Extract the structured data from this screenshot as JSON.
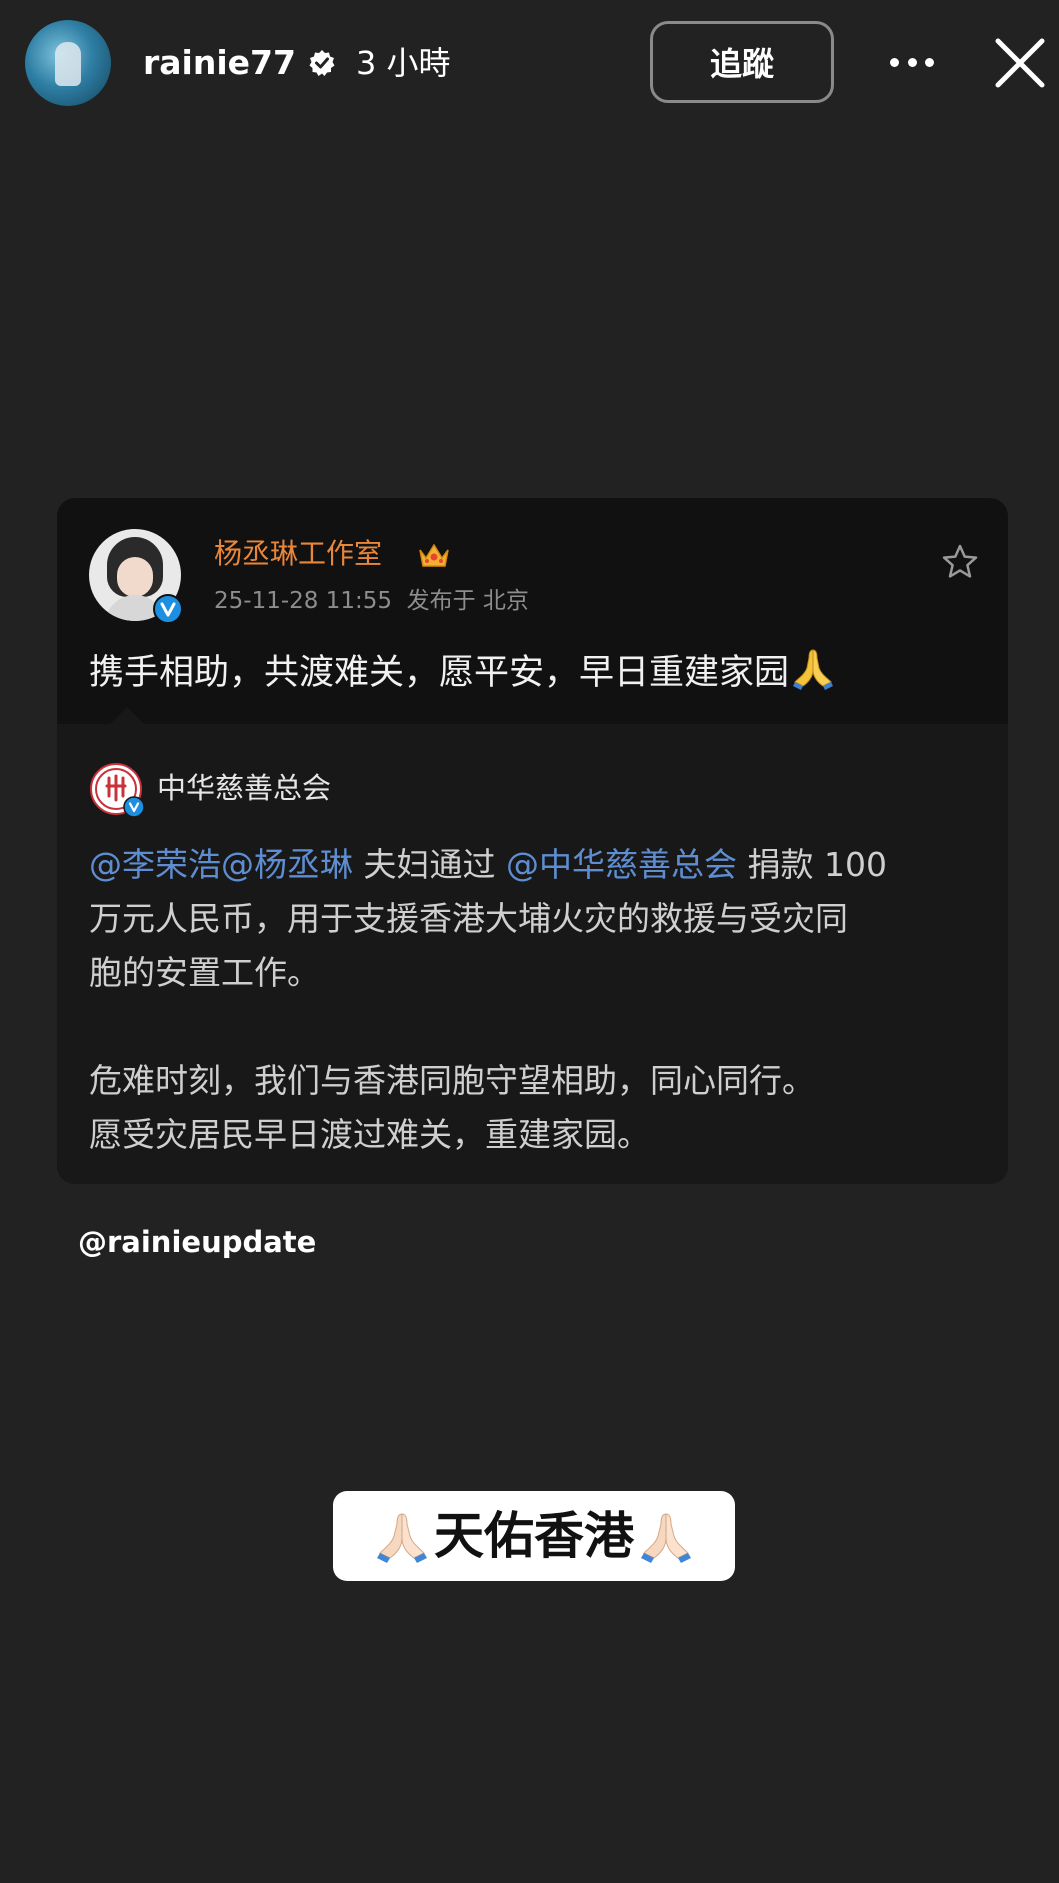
{
  "header": {
    "username": "rainie77",
    "time_ago": "3 小時",
    "follow_label": "追蹤"
  },
  "post": {
    "author": "杨丞琳工作室",
    "date": "25-11-28 11:55",
    "location_label": "发布于 北京",
    "text": "携手相助，共渡难关，愿平安，早日重建家园"
  },
  "repost": {
    "org_name": "中华慈善总会",
    "mention_1": "@李荣浩",
    "mention_2": "@杨丞琳",
    "text_1": " 夫妇通过 ",
    "mention_3": "@中华慈善总会",
    "text_2": " 捐款 100",
    "line_2": "万元人民币，用于支援香港大埔火灾的救援与受灾同",
    "line_3": "胞的安置工作。",
    "line_4": "危难时刻，我们与香港同胞守望相助，同心同行。",
    "line_5": "愿受灾居民早日渡过难关，重建家园。"
  },
  "story": {
    "credit_mention": "@rainieupdate",
    "sticker_text": "天佑香港"
  },
  "colors": {
    "background": "#222222",
    "card_bg": "#111111",
    "author_orange": "#e8873a",
    "mention_blue": "#5e8ed1",
    "verified_blue": "#1d8fe1"
  }
}
